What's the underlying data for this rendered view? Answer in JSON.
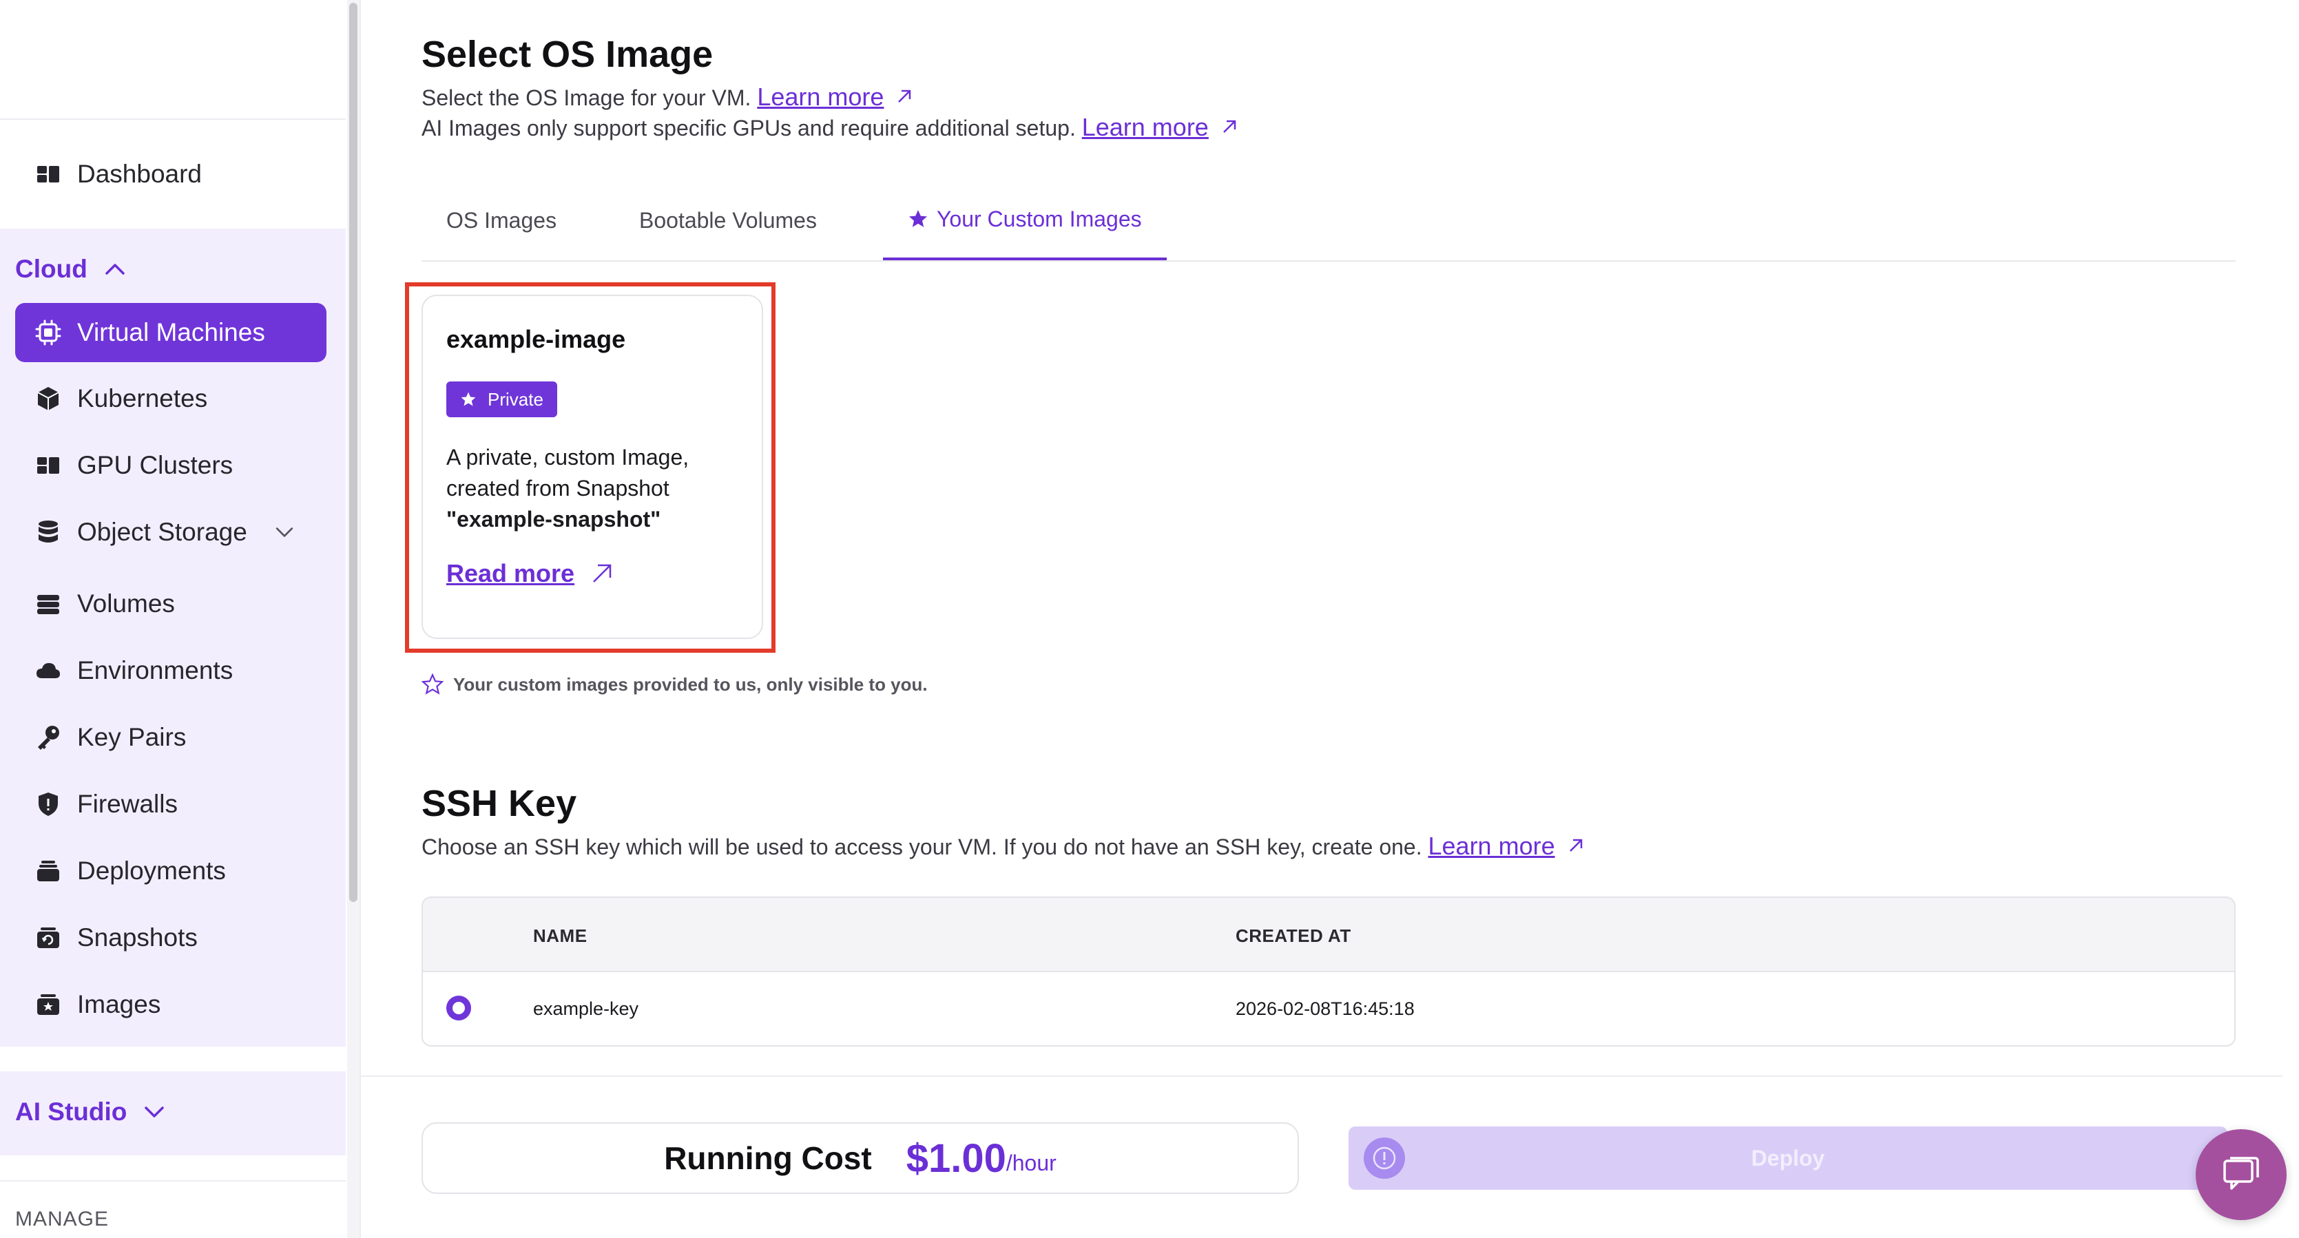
{
  "sidebar": {
    "dashboard": "Dashboard",
    "cloud_group": "Cloud",
    "cloud_items": [
      {
        "label": "Virtual Machines",
        "icon": "chip-icon",
        "active": true
      },
      {
        "label": "Kubernetes",
        "icon": "cube-icon"
      },
      {
        "label": "GPU Clusters",
        "icon": "clusters-icon"
      },
      {
        "label": "Object Storage",
        "icon": "database-icon"
      },
      {
        "label": "Volumes",
        "icon": "volumes-icon"
      },
      {
        "label": "Environments",
        "icon": "cloud-icon"
      },
      {
        "label": "Key Pairs",
        "icon": "key-icon"
      },
      {
        "label": "Firewalls",
        "icon": "shield-icon"
      },
      {
        "label": "Deployments",
        "icon": "stack-icon"
      },
      {
        "label": "Snapshots",
        "icon": "snapshot-icon"
      },
      {
        "label": "Images",
        "icon": "image-icon"
      }
    ],
    "ai_group": "AI Studio",
    "manage_label": "MANAGE"
  },
  "os_image": {
    "title": "Select OS Image",
    "desc1": "Select the OS Image for your VM.",
    "desc2": "AI Images only support specific GPUs and require additional setup.",
    "learn_more": "Learn more",
    "tabs": [
      "OS Images",
      "Bootable Volumes",
      "Your Custom Images"
    ],
    "active_tab": 2,
    "card": {
      "title": "example-image",
      "badge": "Private",
      "desc_prefix": "A private, custom Image, created from Snapshot",
      "snapshot_name": "\"example-snapshot\"",
      "read_more": "Read more"
    },
    "note": "Your custom images provided to us, only visible to you."
  },
  "ssh": {
    "title": "SSH Key",
    "desc": "Choose an SSH key which will be used to access your VM. If you do not have an SSH key, create one.",
    "learn_more": "Learn more",
    "columns": [
      "NAME",
      "CREATED AT"
    ],
    "rows": [
      {
        "name": "example-key",
        "created_at": "2026-02-08T16:45:18",
        "selected": true
      }
    ]
  },
  "footer": {
    "cost_label": "Running Cost",
    "cost_value": "$1.00",
    "cost_unit": "/hour",
    "deploy_label": "Deploy"
  },
  "colors": {
    "accent": "#6f35d9",
    "highlight": "#e23b2a",
    "group_bg": "#f3eefd"
  }
}
